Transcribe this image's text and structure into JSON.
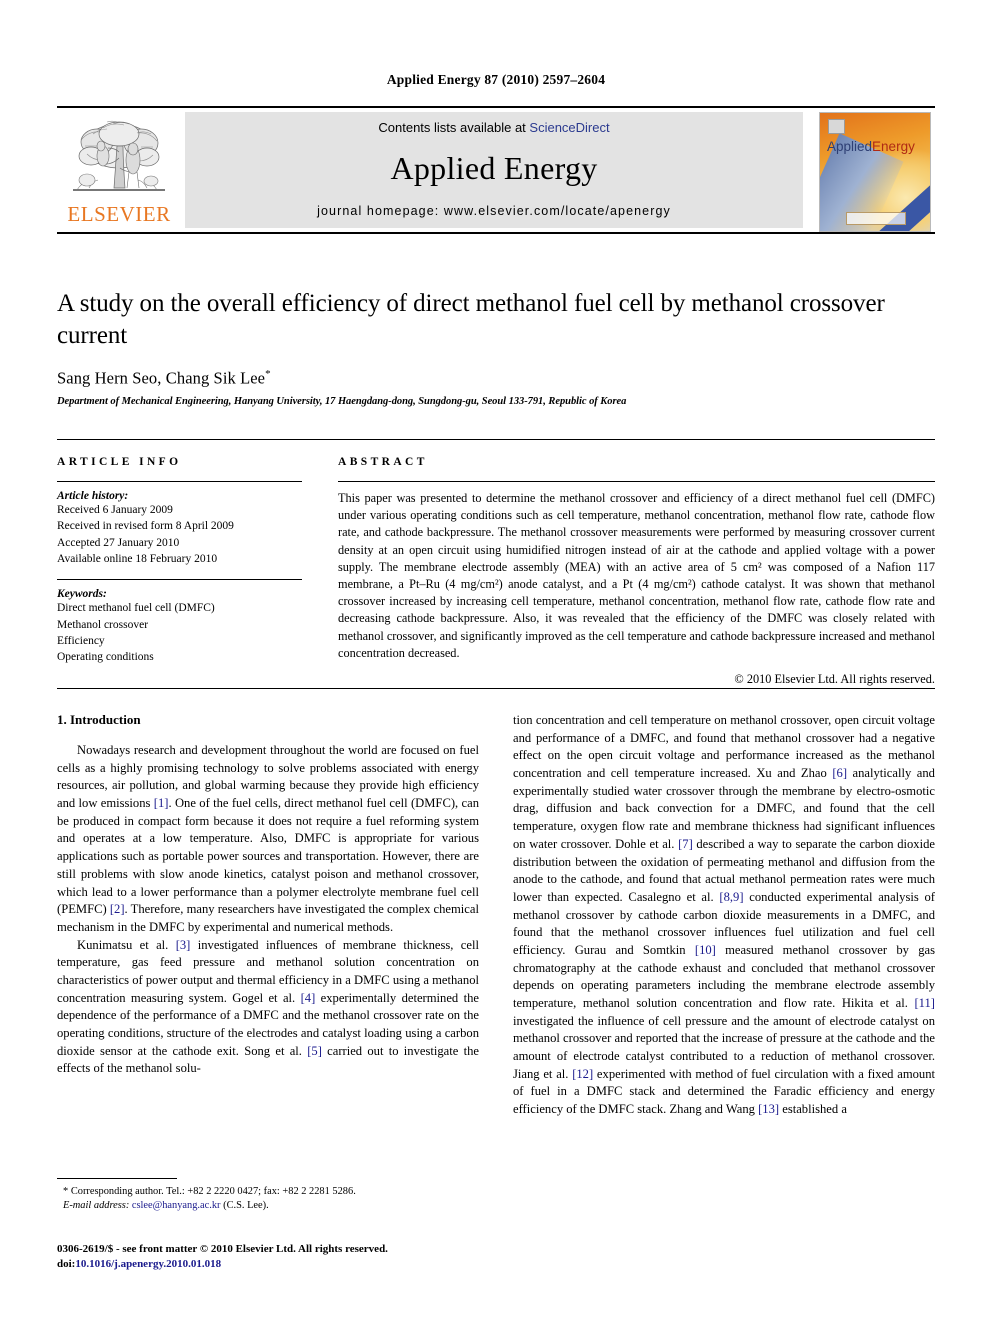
{
  "running_head": "Applied Energy 87 (2010) 2597–2604",
  "masthead": {
    "publisher_name": "ELSEVIER",
    "contents_prefix": "Contents lists available at ",
    "contents_link": "ScienceDirect",
    "journal_name": "Applied Energy",
    "homepage": "journal homepage: www.elsevier.com/locate/apenergy",
    "cover_title_a": "Applied",
    "cover_title_b": "Energy"
  },
  "article": {
    "title": "A study on the overall efficiency of direct methanol fuel cell by methanol crossover current",
    "authors": "Sang Hern Seo, Chang Sik Lee",
    "author_marker": "*",
    "affiliation": "Department of Mechanical Engineering, Hanyang University, 17 Haengdang-dong, Sungdong-gu, Seoul 133-791, Republic of Korea"
  },
  "info": {
    "heading": "ARTICLE INFO",
    "history_label": "Article history:",
    "history": [
      "Received 6 January 2009",
      "Received in revised form 8 April 2009",
      "Accepted 27 January 2010",
      "Available online 18 February 2010"
    ],
    "keywords_label": "Keywords:",
    "keywords": [
      "Direct methanol fuel cell (DMFC)",
      "Methanol crossover",
      "Efficiency",
      "Operating conditions"
    ]
  },
  "abstract": {
    "heading": "ABSTRACT",
    "text": "This paper was presented to determine the methanol crossover and efficiency of a direct methanol fuel cell (DMFC) under various operating conditions such as cell temperature, methanol concentration, methanol flow rate, cathode flow rate, and cathode backpressure. The methanol crossover measurements were performed by measuring crossover current density at an open circuit using humidified nitrogen instead of air at the cathode and applied voltage with a power supply. The membrane electrode assembly (MEA) with an active area of 5 cm² was composed of a Nafion 117 membrane, a Pt–Ru (4 mg/cm²) anode catalyst, and a Pt (4 mg/cm²) cathode catalyst. It was shown that methanol crossover increased by increasing cell temperature, methanol concentration, methanol flow rate, cathode flow rate and decreasing cathode backpressure. Also, it was revealed that the efficiency of the DMFC was closely related with methanol crossover, and significantly improved as the cell temperature and cathode backpressure increased and methanol concentration decreased.",
    "copyright": "© 2010 Elsevier Ltd. All rights reserved."
  },
  "body": {
    "section_number_title": "1. Introduction",
    "left_para_1_a": "Nowadays research and development throughout the world are focused on fuel cells as a highly promising technology to solve problems associated with energy resources, air pollution, and global warming because they provide high efficiency and low emissions ",
    "left_para_1_ref1": "[1]",
    "left_para_1_b": ". One of the fuel cells, direct methanol fuel cell (DMFC), can be produced in compact form because it does not require a fuel reforming system and operates at a low temperature. Also, DMFC is appropriate for various applications such as portable power sources and transportation. However, there are still problems with slow anode kinetics, catalyst poison and methanol crossover, which lead to a lower performance than a polymer electrolyte membrane fuel cell (PEMFC) ",
    "left_para_1_ref2": "[2]",
    "left_para_1_c": ". Therefore, many researchers have investigated the complex chemical mechanism in the DMFC by experimental and numerical methods.",
    "left_para_2_a": "Kunimatsu et al. ",
    "left_para_2_ref3": "[3]",
    "left_para_2_b": " investigated influences of membrane thickness, cell temperature, gas feed pressure and methanol solution concentration on characteristics of power output and thermal efficiency in a DMFC using a methanol concentration measuring system. Gogel et al. ",
    "left_para_2_ref4": "[4]",
    "left_para_2_c": " experimentally determined the dependence of the performance of a DMFC and the methanol crossover rate on the operating conditions, structure of the electrodes and catalyst loading using a carbon dioxide sensor at the cathode exit. Song et al. ",
    "left_para_2_ref5": "[5]",
    "left_para_2_d": " carried out to investigate the effects of the methanol solu-",
    "right_a": "tion concentration and cell temperature on methanol crossover, open circuit voltage and performance of a DMFC, and found that methanol crossover had a negative effect on the open circuit voltage and performance increased as the methanol concentration and cell temperature increased. Xu and Zhao ",
    "right_ref6": "[6]",
    "right_b": " analytically and experimentally studied water crossover through the membrane by electro-osmotic drag, diffusion and back convection for a DMFC, and found that the cell temperature, oxygen flow rate and membrane thickness had significant influences on water crossover. Dohle et al. ",
    "right_ref7": "[7]",
    "right_c": " described a way to separate the carbon dioxide distribution between the oxidation of permeating methanol and diffusion from the anode to the cathode, and found that actual methanol permeation rates were much lower than expected. Casalegno et al. ",
    "right_ref89": "[8,9]",
    "right_d": " conducted experimental analysis of methanol crossover by cathode carbon dioxide measurements in a DMFC, and found that the methanol crossover influences fuel utilization and fuel cell efficiency. Gurau and Somtkin ",
    "right_ref10": "[10]",
    "right_e": " measured methanol crossover by gas chromatography at the cathode exhaust and concluded that methanol crossover depends on operating parameters including the membrane electrode assembly temperature, methanol solution concentration and flow rate. Hikita et al. ",
    "right_ref11": "[11]",
    "right_f": " investigated the influence of cell pressure and the amount of electrode catalyst on methanol crossover and reported that the increase of pressure at the cathode and the amount of electrode catalyst contributed to a reduction of methanol crossover. Jiang et al. ",
    "right_ref12": "[12]",
    "right_g": " experimented with method of fuel circulation with a fixed amount of fuel in a DMFC stack and determined the Faradic efficiency and energy efficiency of the DMFC stack. Zhang and Wang ",
    "right_ref13": "[13]",
    "right_h": " established a"
  },
  "footnotes": {
    "corresponding_marker": "*",
    "corresponding": "Corresponding author. Tel.: +82 2 2220 0427; fax: +82 2 2281 5286.",
    "email_label": "E-mail address:",
    "email": "cslee@hanyang.ac.kr",
    "email_owner": "(C.S. Lee).",
    "issn_line": "0306-2619/$ - see front matter © 2010 Elsevier Ltd. All rights reserved.",
    "doi_label": "doi:",
    "doi_value": "10.1016/j.apenergy.2010.01.018"
  }
}
